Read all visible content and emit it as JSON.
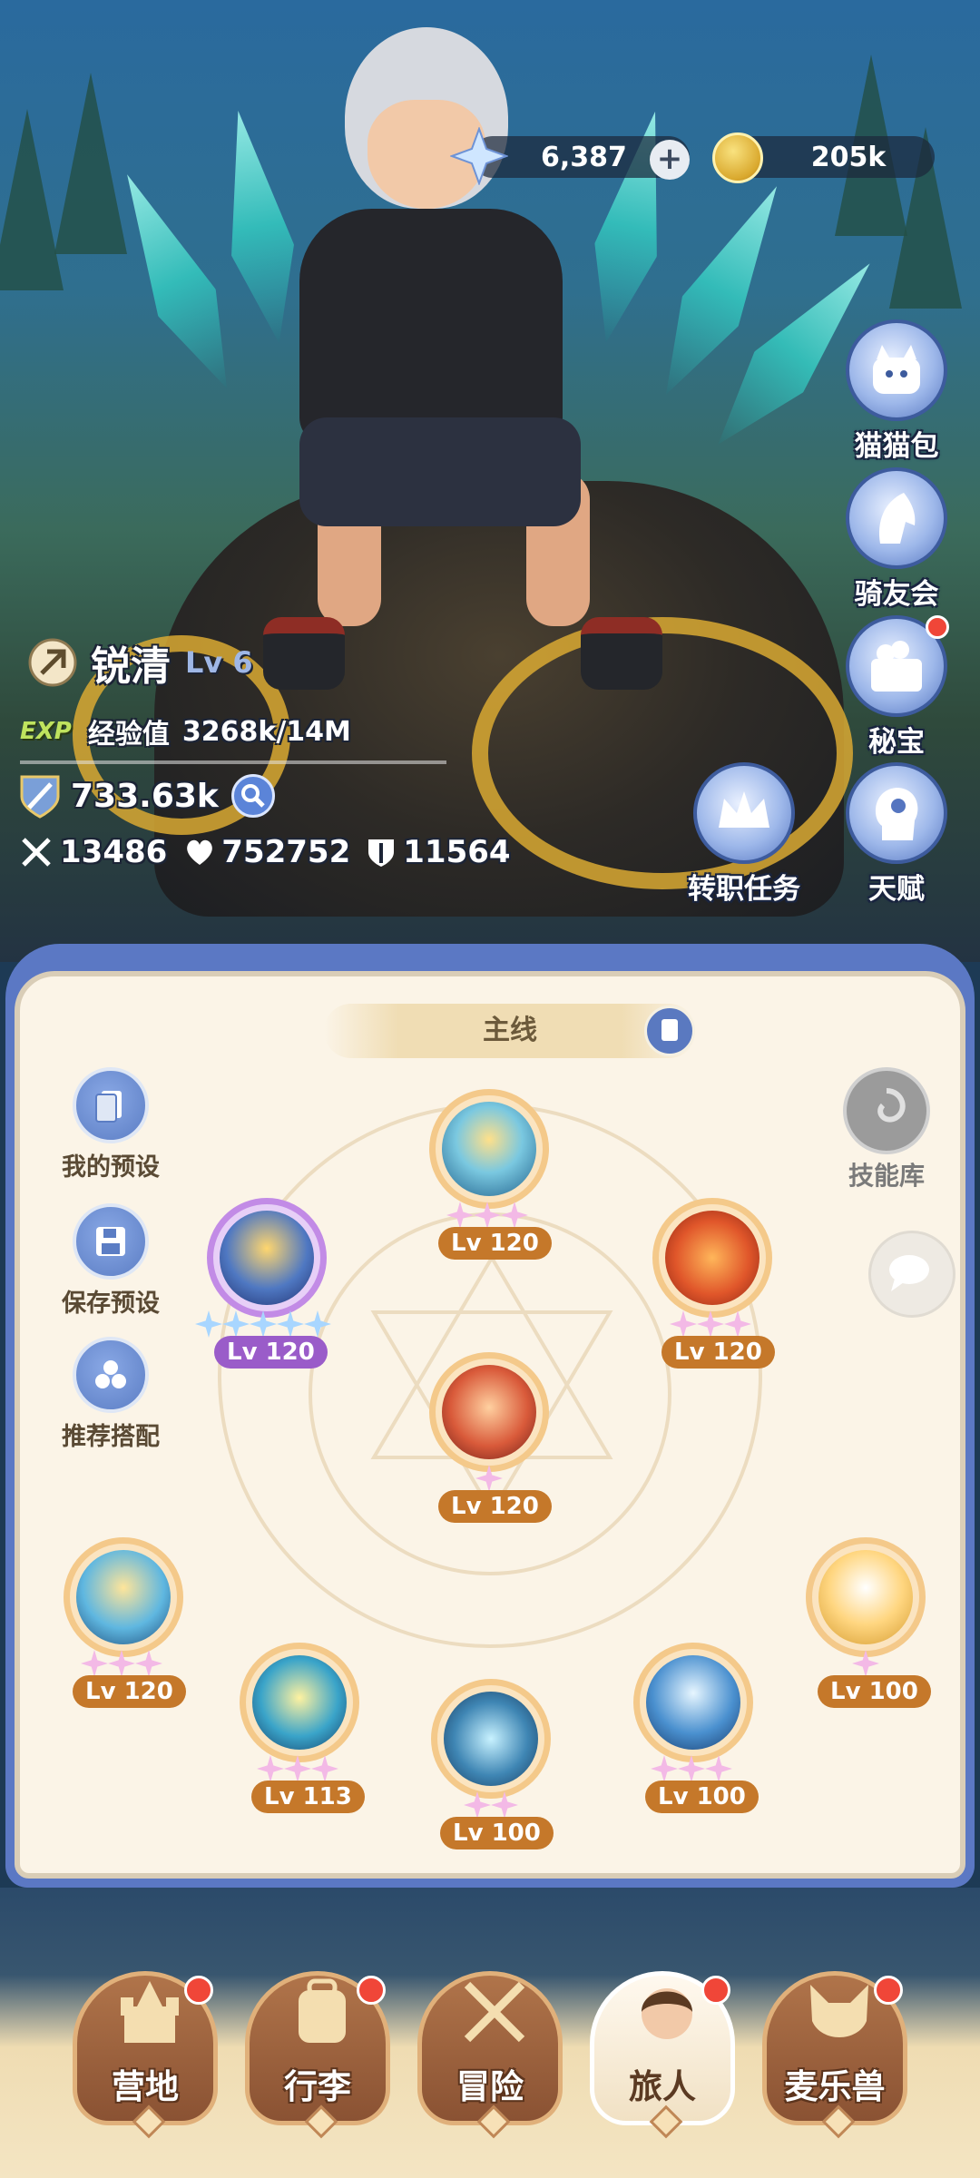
{
  "currency": {
    "crystal_amount": "6,387",
    "coin_amount": "205k"
  },
  "side_menu": {
    "items": [
      {
        "label": "猫猫包",
        "badge": false
      },
      {
        "label": "骑友会",
        "badge": false
      },
      {
        "label": "秘宝",
        "badge": true
      },
      {
        "label": "天赋",
        "badge": false
      }
    ],
    "job_quest_label": "转职任务"
  },
  "player": {
    "name": "锐清",
    "level": "Lv 6",
    "exp_tag": "EXP",
    "exp_label": "经验值",
    "exp_value": "3268k/14M",
    "power": "733.63k",
    "attack": "13486",
    "hp": "752752",
    "defense": "11564"
  },
  "panel": {
    "tab_title": "主线",
    "tools": [
      {
        "label": "我的预设"
      },
      {
        "label": "保存预设"
      },
      {
        "label": "推荐搭配"
      }
    ],
    "skill_library_label": "技能库",
    "skills": [
      {
        "id": "top",
        "level": "Lv 120",
        "stars": 3
      },
      {
        "id": "upper-left",
        "level": "Lv 120",
        "stars": 5
      },
      {
        "id": "upper-right",
        "level": "Lv 120",
        "stars": 3
      },
      {
        "id": "center",
        "level": "Lv 120",
        "stars": 1
      },
      {
        "id": "bottom-1",
        "level": "Lv 120",
        "stars": 3
      },
      {
        "id": "bottom-2",
        "level": "Lv 113",
        "stars": 3
      },
      {
        "id": "bottom-3",
        "level": "Lv 100",
        "stars": 2
      },
      {
        "id": "bottom-4",
        "level": "Lv 100",
        "stars": 3
      },
      {
        "id": "bottom-5",
        "level": "Lv 100",
        "stars": 1
      }
    ]
  },
  "bottom_nav": {
    "items": [
      {
        "label": "营地",
        "badge": true,
        "active": false
      },
      {
        "label": "行李",
        "badge": true,
        "active": false
      },
      {
        "label": "冒险",
        "badge": false,
        "active": false
      },
      {
        "label": "旅人",
        "badge": true,
        "active": true
      },
      {
        "label": "麦乐兽",
        "badge": true,
        "active": false
      }
    ]
  },
  "colors": {
    "panel_frame": "#5b78c4",
    "panel_bg": "#fbf4e7",
    "level_badge": "#c5782a",
    "badge_red": "#f04638"
  }
}
